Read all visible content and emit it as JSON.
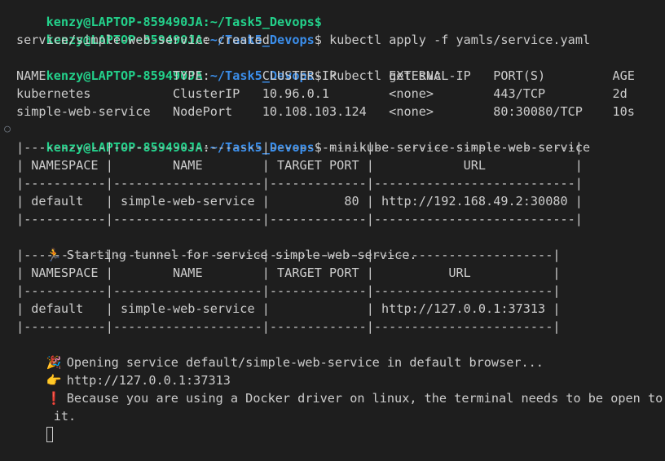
{
  "prompt": {
    "user_host": "kenzy@LAPTOP-859490JA",
    "sep": ":",
    "path": "~/Task5_Devops",
    "symbol": "$"
  },
  "lines": {
    "partial_top": "kenzy@LAPTOP-859490JA:~/Task5_Devops$",
    "cmd1": " kubectl apply -f yamls/service.yaml",
    "out1": "service/simple-web-service created",
    "cmd2": " kubectl get svc",
    "svc_header": "NAME                 TYPE        CLUSTER-IP       EXTERNAL-IP   PORT(S)         AGE",
    "svc_row1": "kubernetes           ClusterIP   10.96.0.1        <none>        443/TCP         2d",
    "svc_row2": "simple-web-service   NodePort    10.108.103.124   <none>        80:30080/TCP    10s",
    "cmd3": " minikube service simple-web-service",
    "t1_sep_top": "|-----------|--------------------|-------------|---------------------------|",
    "t1_header": "| NAMESPACE |        NAME        | TARGET PORT |            URL            |",
    "t1_sep_mid": "|-----------|--------------------|-------------|---------------------------|",
    "t1_row": "| default   | simple-web-service |          80 | http://192.168.49.2:30080 |",
    "t1_sep_bot": "|-----------|--------------------|-------------|---------------------------|",
    "tunnel_msg": "Starting tunnel for service simple-web-service.",
    "t2_sep_top": "|-----------|--------------------|-------------|------------------------|",
    "t2_header": "| NAMESPACE |        NAME        | TARGET PORT |          URL           |",
    "t2_sep_mid": "|-----------|--------------------|-------------|------------------------|",
    "t2_row": "| default   | simple-web-service |             | http://127.0.0.1:37313 |",
    "t2_sep_bot": "|-----------|--------------------|-------------|------------------------|",
    "open_msg": "Opening service default/simple-web-service in default browser...",
    "url_msg": "http://127.0.0.1:37313",
    "warn_msg": "Because you are using a Docker driver on linux, the terminal needs to be open to run",
    "warn_cont": "it."
  },
  "icons": {
    "run": "🏃",
    "party": "🎉",
    "point": "👉",
    "bang": "❗"
  },
  "gutter": {
    "dot": "○"
  },
  "colors": {
    "background": "#1e1e1e",
    "prompt_user": "#23d18b",
    "prompt_path": "#3b8eea",
    "text": "#cccccc"
  }
}
